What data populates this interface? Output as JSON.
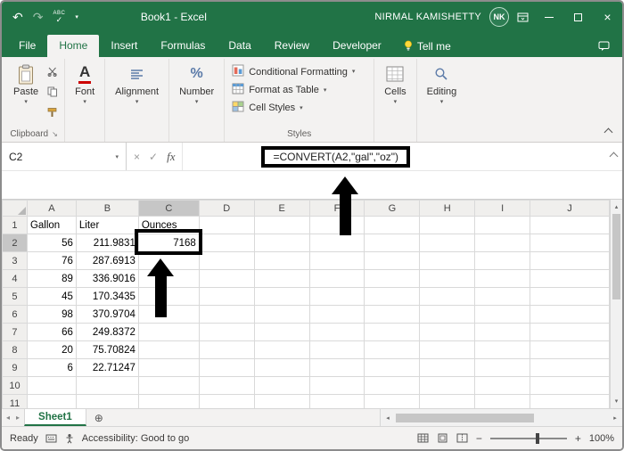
{
  "titlebar": {
    "title": "Book1 - Excel",
    "user_name": "NIRMAL KAMISHETTY",
    "user_initials": "NK"
  },
  "icons": {
    "undo": "↶",
    "redo": "↷",
    "spellcheck_abc": "ABC",
    "spellcheck_check": "✓",
    "dropdown": "▾",
    "close": "×",
    "cancel": "×",
    "enter": "✓",
    "dialog_launcher": "↘",
    "add_sheet": "⊕",
    "nav_left": "◂",
    "nav_right": "▸",
    "scroll_up": "▴",
    "scroll_down": "▾",
    "zoom_minus": "−",
    "zoom_plus": "+"
  },
  "tabs": [
    "File",
    "Home",
    "Insert",
    "Formulas",
    "Data",
    "Review",
    "Developer"
  ],
  "tellme_label": "Tell me",
  "ribbon": {
    "paste": "Paste",
    "font": "Font",
    "alignment": "Alignment",
    "number": "Number",
    "conditional_formatting": "Conditional Formatting",
    "format_as_table": "Format as Table",
    "cell_styles": "Cell Styles",
    "cells": "Cells",
    "editing": "Editing",
    "group_clipboard": "Clipboard",
    "group_styles": "Styles"
  },
  "formula_bar": {
    "name_box": "C2",
    "fx": "fx",
    "formula": "=CONVERT(A2,\"gal\",\"oz\")"
  },
  "grid": {
    "columns": [
      "A",
      "B",
      "C",
      "D",
      "E",
      "F",
      "G",
      "H",
      "I",
      "J"
    ],
    "row_numbers": [
      "1",
      "2",
      "3",
      "4",
      "5",
      "6",
      "7",
      "8",
      "9",
      "10",
      "11"
    ],
    "rows": [
      [
        "Gallon",
        "Liter",
        "Ounces",
        "",
        "",
        "",
        "",
        "",
        "",
        ""
      ],
      [
        "56",
        "211.9831",
        "7168",
        "",
        "",
        "",
        "",
        "",
        "",
        ""
      ],
      [
        "76",
        "287.6913",
        "",
        "",
        "",
        "",
        "",
        "",
        "",
        ""
      ],
      [
        "89",
        "336.9016",
        "",
        "",
        "",
        "",
        "",
        "",
        "",
        ""
      ],
      [
        "45",
        "170.3435",
        "",
        "",
        "",
        "",
        "",
        "",
        "",
        ""
      ],
      [
        "98",
        "370.9704",
        "",
        "",
        "",
        "",
        "",
        "",
        "",
        ""
      ],
      [
        "66",
        "249.8372",
        "",
        "",
        "",
        "",
        "",
        "",
        "",
        ""
      ],
      [
        "20",
        "75.70824",
        "",
        "",
        "",
        "",
        "",
        "",
        "",
        ""
      ],
      [
        "6",
        "22.71247",
        "",
        "",
        "",
        "",
        "",
        "",
        "",
        ""
      ],
      [
        "",
        "",
        "",
        "",
        "",
        "",
        "",
        "",
        "",
        ""
      ],
      [
        "",
        "",
        "",
        "",
        "",
        "",
        "",
        "",
        "",
        ""
      ]
    ],
    "selected_cell": "C2"
  },
  "sheet_bar": {
    "active_tab": "Sheet1"
  },
  "status_bar": {
    "ready": "Ready",
    "accessibility": "Accessibility: Good to go",
    "zoom_level": "100%"
  },
  "colors": {
    "excel_green": "#217346",
    "annotation": "#000000"
  }
}
